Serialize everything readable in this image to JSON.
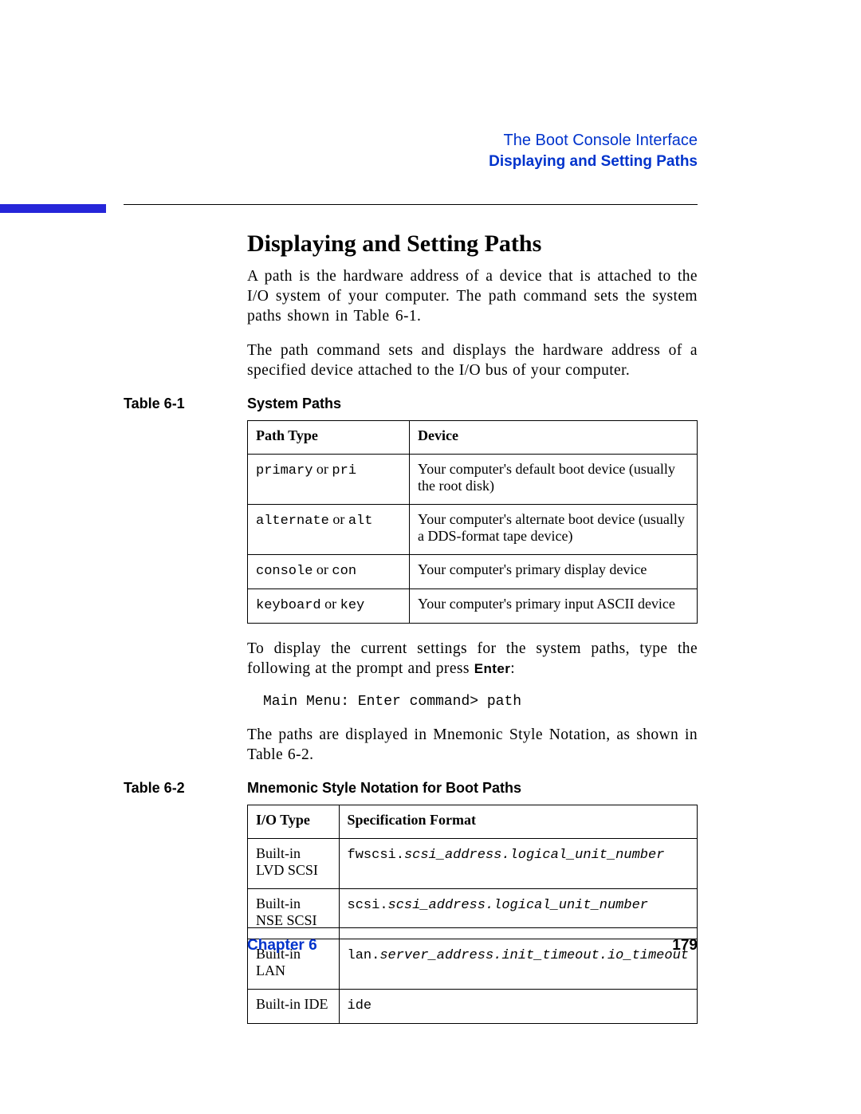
{
  "header": {
    "chapter_title": "The Boot Console Interface",
    "section_title": "Displaying and Setting Paths"
  },
  "heading": "Displaying and Setting Paths",
  "p1": "A path is the hardware address of a device that is attached to the I/O system of your computer. The path command sets the system paths shown in Table 6-1.",
  "p2": "The path command sets and displays the hardware address of a specified device attached to the I/O bus of your computer.",
  "table1": {
    "label_num": "Table 6-1",
    "caption": "System Paths",
    "headers": {
      "c1": "Path Type",
      "c2": "Device"
    },
    "rows": [
      {
        "pt_a": "primary",
        "pt_or": " or ",
        "pt_b": "pri",
        "dev": "Your computer's default boot device (usually the root disk)"
      },
      {
        "pt_a": "alternate",
        "pt_or": " or ",
        "pt_b": "alt",
        "dev": "Your computer's alternate boot device (usually a DDS-format tape device)"
      },
      {
        "pt_a": "console",
        "pt_or": " or ",
        "pt_b": "con",
        "dev": "Your computer's primary display device"
      },
      {
        "pt_a": "keyboard",
        "pt_or": " or ",
        "pt_b": "key",
        "dev": "Your computer's primary input ASCII device"
      }
    ]
  },
  "p3_a": "To display the current settings for the system paths, type the following at the prompt and press ",
  "p3_key": "Enter",
  "p3_b": ":",
  "cmd": "Main Menu: Enter command> path",
  "p4": "The paths are displayed in Mnemonic Style Notation, as shown in Table 6-2.",
  "table2": {
    "label_num": "Table 6-2",
    "caption": "Mnemonic Style Notation for Boot Paths",
    "headers": {
      "c1": "I/O Type",
      "c2": "Specification Format"
    },
    "rows": [
      {
        "io": "Built-in LVD SCSI",
        "fmt_pre": "fwscsi.",
        "fmt_it": "scsi_address.logical_unit_number"
      },
      {
        "io": "Built-in NSE SCSI",
        "fmt_pre": "scsi.",
        "fmt_it": "scsi_address.logical_unit_number"
      },
      {
        "io": "Built-in LAN",
        "fmt_pre": "lan.",
        "fmt_it": "server_address.init_timeout.io_timeout"
      },
      {
        "io": "Built-in IDE",
        "fmt_pre": "ide",
        "fmt_it": ""
      }
    ]
  },
  "footer": {
    "chapter": "Chapter 6",
    "page": "179"
  }
}
